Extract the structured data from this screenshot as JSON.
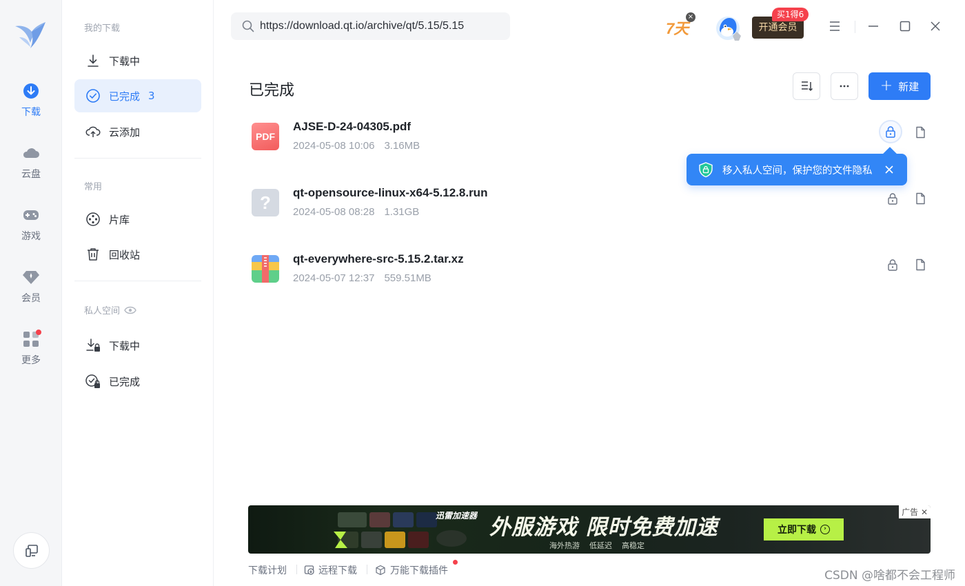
{
  "rail": {
    "items": [
      {
        "label": "下载"
      },
      {
        "label": "云盘"
      },
      {
        "label": "游戏"
      },
      {
        "label": "会员"
      },
      {
        "label": "更多"
      }
    ]
  },
  "nav": {
    "sections": {
      "my_downloads": "我的下载",
      "common": "常用",
      "private": "私人空间"
    },
    "items": {
      "downloading": "下载中",
      "completed": "已完成",
      "completed_count": "3",
      "cloud_add": "云添加",
      "library": "片库",
      "recycle": "回收站",
      "private_downloading": "下载中",
      "private_completed": "已完成"
    }
  },
  "topbar": {
    "search_value": "https://download.qt.io/archive/qt/5.15/5.15",
    "promo_days": "7天",
    "vip_label": "开通会员",
    "vip_badge": "买1得6"
  },
  "content": {
    "title": "已完成",
    "new_label": "新建",
    "files": [
      {
        "name": "AJSE-D-24-04305.pdf",
        "date": "2024-05-08 10:06",
        "size": "3.16MB",
        "icon": "pdf-icon",
        "icon_text": "PDF"
      },
      {
        "name": "qt-opensource-linux-x64-5.12.8.run",
        "date": "2024-05-08 08:28",
        "size": "1.31GB",
        "icon": "unknown-file-icon",
        "icon_text": "?"
      },
      {
        "name": "qt-everywhere-src-5.15.2.tar.xz",
        "date": "2024-05-07 12:37",
        "size": "559.51MB",
        "icon": "archive-icon"
      }
    ],
    "tooltip": "移入私人空间，保护您的文件隐私"
  },
  "ad": {
    "brand": "迅雷加速器",
    "headline": "外服游戏 限时免费加速",
    "subs": [
      "海外热游",
      "低延迟",
      "高稳定"
    ],
    "cta": "立即下载",
    "tag": "广告"
  },
  "footer": {
    "plan": "下载计划",
    "remote": "远程下载",
    "plugin": "万能下载插件"
  },
  "watermark": "CSDN @啥都不会工程师",
  "colors": {
    "accent": "#2e7cf6",
    "tooltip": "#3286f6",
    "badge": "#f5414c",
    "vip_bg": "#3a2f24",
    "ad_cta": "#b7f046"
  }
}
